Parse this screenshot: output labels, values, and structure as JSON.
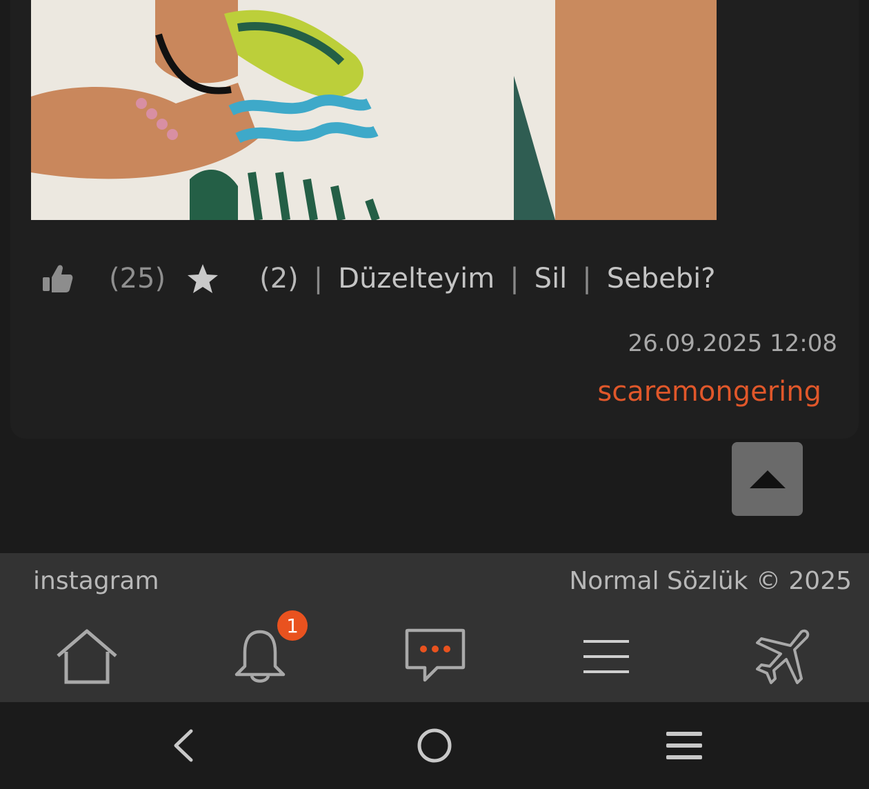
{
  "entry": {
    "like_count": "(25)",
    "fav_count": "(2)",
    "separator": "|",
    "edit_label": "Düzelteyim",
    "delete_label": "Sil",
    "reason_label": "Sebebi?",
    "timestamp": "26.09.2025 12:08",
    "author": "scaremongering"
  },
  "footer": {
    "instagram_label": "instagram",
    "copyright": "Normal Sözlük © 2025"
  },
  "bottom_nav": {
    "items": [
      {
        "icon": "home-icon"
      },
      {
        "icon": "bell-icon",
        "badge": "1"
      },
      {
        "icon": "message-icon"
      },
      {
        "icon": "menu-icon"
      },
      {
        "icon": "plane-icon"
      }
    ]
  },
  "system_nav": {
    "items": [
      {
        "icon": "back-icon"
      },
      {
        "icon": "home-circle-icon"
      },
      {
        "icon": "recents-icon"
      }
    ]
  },
  "colors": {
    "background": "#1b1b1b",
    "card": "#1f1f1f",
    "accent": "#e0572a",
    "badge": "#e9521f",
    "nav_bar": "#333333"
  }
}
